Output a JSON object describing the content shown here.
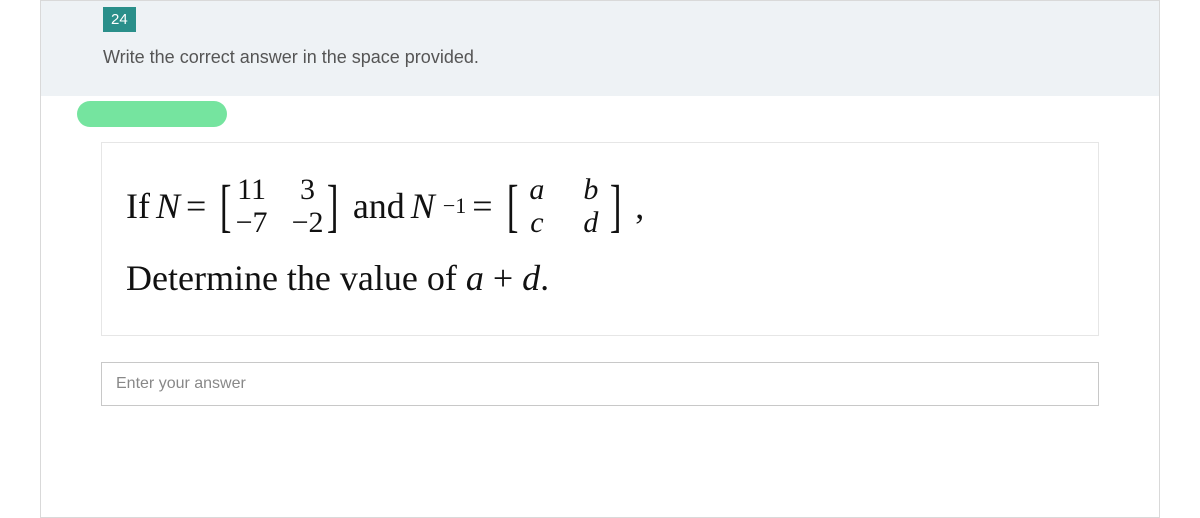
{
  "question": {
    "number": "24",
    "instruction": "Write the correct answer in the space provided.",
    "line1": {
      "if": "If ",
      "N": "N",
      "eq1": " = ",
      "matrixN": {
        "r1c1": "11",
        "r1c2": "3",
        "r2c1": "−7",
        "r2c2": "−2"
      },
      "and": " and ",
      "Ninv_N": "N",
      "Ninv_exp": "−1",
      "eq2": " = ",
      "matrixInv": {
        "r1c1": "a",
        "r1c2": "b",
        "r2c1": "c",
        "r2c2": "d"
      },
      "comma": ","
    },
    "line2": {
      "pre": "Determine the value of ",
      "a": "a",
      "plus": " + ",
      "d": "d",
      "dot": "."
    },
    "answer_placeholder": "Enter your answer"
  }
}
